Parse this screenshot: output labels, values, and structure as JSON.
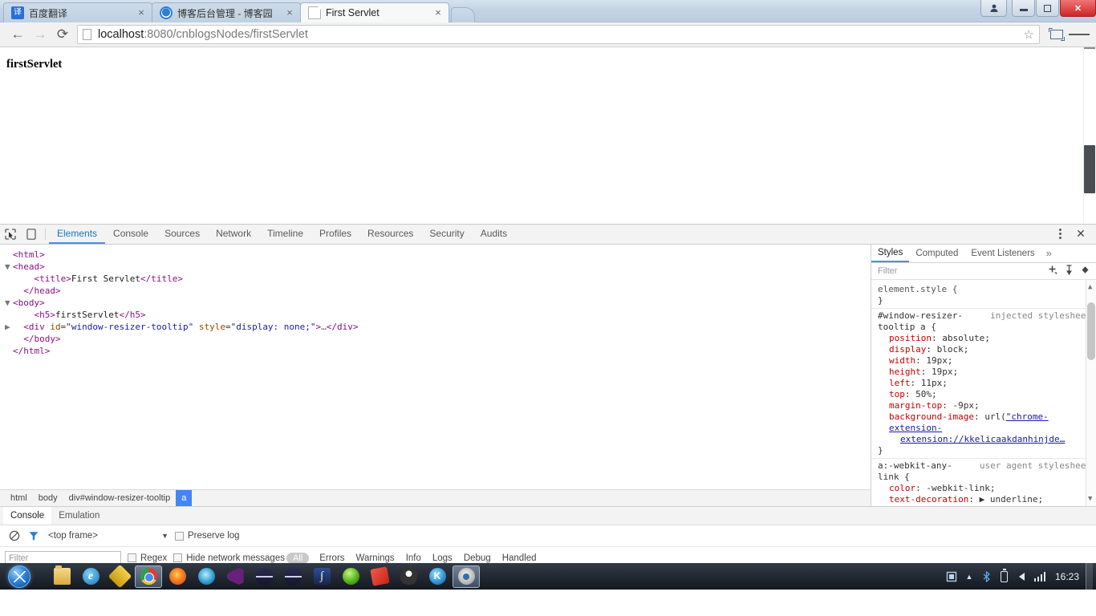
{
  "browser": {
    "tabs": [
      {
        "title": "百度翻译",
        "favicon": "baidu-fanyi-icon",
        "active": false,
        "close_label": "×"
      },
      {
        "title": "博客后台管理 - 博客园",
        "favicon": "cnblogs-icon",
        "active": false,
        "close_label": "×"
      },
      {
        "title": "First Servlet",
        "favicon": "document-icon",
        "active": true,
        "close_label": "×"
      }
    ],
    "window_controls": {
      "user_label": "■",
      "minimize_label": "",
      "restore_label": "",
      "close_label": "✕"
    },
    "toolbar": {
      "back_label": "←",
      "forward_label": "→",
      "reload_label": "⟳",
      "url_scheme_host": "localhost",
      "url_rest": ":8080/cnblogsNodes/firstServlet",
      "url_full": "localhost:8080/cnblogsNodes/firstServlet",
      "bookmark_label": "☆",
      "extension_label": "window-resizer",
      "menu_label": "≡"
    }
  },
  "page": {
    "heading": "firstServlet"
  },
  "devtools": {
    "toolbar_icons": [
      {
        "name": "inspect-element-icon",
        "glyph": "⬈"
      },
      {
        "name": "device-toolbar-icon",
        "glyph": "▯"
      }
    ],
    "tabs": [
      {
        "label": "Elements",
        "active": true
      },
      {
        "label": "Console",
        "active": false
      },
      {
        "label": "Sources",
        "active": false
      },
      {
        "label": "Network",
        "active": false
      },
      {
        "label": "Timeline",
        "active": false
      },
      {
        "label": "Profiles",
        "active": false
      },
      {
        "label": "Resources",
        "active": false
      },
      {
        "label": "Security",
        "active": false
      },
      {
        "label": "Audits",
        "active": false
      }
    ],
    "more_menu_label": "⋮",
    "close_label": "✕",
    "dom_tree": [
      {
        "indent": 0,
        "arrow": "",
        "html": "<span class=\"punc\">&lt;</span><span class=\"tagc\">html</span><span class=\"punc\">&gt;</span>"
      },
      {
        "indent": 0,
        "arrow": "▼",
        "html": "<span class=\"punc\">&lt;</span><span class=\"tagc\">head</span><span class=\"punc\">&gt;</span>"
      },
      {
        "indent": 2,
        "arrow": "",
        "html": "<span class=\"punc\">&lt;</span><span class=\"tagc\">title</span><span class=\"punc\">&gt;</span><span class=\"txt\">First Servlet</span><span class=\"punc\">&lt;/</span><span class=\"tagc\">title</span><span class=\"punc\">&gt;</span>"
      },
      {
        "indent": 1,
        "arrow": "",
        "html": "<span class=\"punc\">&lt;/</span><span class=\"tagc\">head</span><span class=\"punc\">&gt;</span>"
      },
      {
        "indent": 0,
        "arrow": "▼",
        "html": "<span class=\"punc\">&lt;</span><span class=\"tagc\">body</span><span class=\"punc\">&gt;</span>"
      },
      {
        "indent": 2,
        "arrow": "",
        "html": "<span class=\"punc\">&lt;</span><span class=\"tagc\">h5</span><span class=\"punc\">&gt;</span><span class=\"txt\">firstServlet</span><span class=\"punc\">&lt;/</span><span class=\"tagc\">h5</span><span class=\"punc\">&gt;</span>"
      },
      {
        "indent": 1,
        "arrow": "▶",
        "html": "<span class=\"punc\">&lt;</span><span class=\"tagc\">div</span> <span class=\"attrn\">id</span>=<span class=\"attrv\">\"window-resizer-tooltip\"</span> <span class=\"attrn\">style</span>=<span class=\"attrv\">\"display: none;\"</span><span class=\"punc\">&gt;</span><span class=\"ellip\">…</span><span class=\"punc\">&lt;/</span><span class=\"tagc\">div</span><span class=\"punc\">&gt;</span>"
      },
      {
        "indent": 1,
        "arrow": "",
        "html": "<span class=\"punc\">&lt;/</span><span class=\"tagc\">body</span><span class=\"punc\">&gt;</span>"
      },
      {
        "indent": 0,
        "arrow": "",
        "html": "<span class=\"punc\">&lt;/</span><span class=\"tagc\">html</span><span class=\"punc\">&gt;</span>"
      }
    ],
    "breadcrumb": [
      {
        "label": "html",
        "selected": false
      },
      {
        "label": "body",
        "selected": false
      },
      {
        "label": "div#window-resizer-tooltip",
        "selected": false
      },
      {
        "label": "a",
        "selected": true
      }
    ],
    "styles_panel": {
      "tabs": [
        {
          "label": "Styles",
          "active": true
        },
        {
          "label": "Computed",
          "active": false
        },
        {
          "label": "Event Listeners",
          "active": false
        }
      ],
      "more_label": "»",
      "filter_placeholder": "Filter",
      "icons": [
        {
          "name": "new-style-rule-icon",
          "glyph": "+"
        },
        {
          "name": "toggle-element-state-icon",
          "glyph": "⚑"
        },
        {
          "name": "class-filter-icon",
          "glyph": "◆"
        }
      ],
      "rules": [
        {
          "selector": "element.style {",
          "origin": "",
          "declarations": [],
          "closing": "}"
        },
        {
          "selector": "#window-resizer-tooltip a {",
          "selector_line1": "#window-resizer-",
          "selector_line2": "tooltip a {",
          "origin": "injected stylesheet",
          "declarations": [
            {
              "name": "position",
              "value": "absolute;"
            },
            {
              "name": "display",
              "value": "block;"
            },
            {
              "name": "width",
              "value": "19px;"
            },
            {
              "name": "height",
              "value": "19px;"
            },
            {
              "name": "left",
              "value": "11px;"
            },
            {
              "name": "top",
              "value": "50%;"
            },
            {
              "name": "margin-top",
              "value": "-9px;"
            },
            {
              "name": "background-image",
              "value": "url(",
              "link": "\"chrome-extension://kkelicaakdanhinjde…",
              "after": ""
            }
          ],
          "closing": "}"
        },
        {
          "selector": "a:-webkit-any-link {",
          "selector_line1": "a:-webkit-any-",
          "selector_line2": "link {",
          "origin": "user agent stylesheet",
          "declarations": [
            {
              "name": "color",
              "value": "-webkit-link;"
            },
            {
              "name": "text-decoration",
              "value": "▶ underline;"
            }
          ],
          "closing": ""
        }
      ]
    },
    "drawer": {
      "tabs": [
        {
          "label": "Console",
          "active": true
        },
        {
          "label": "Emulation",
          "active": false
        }
      ],
      "toolbar": {
        "clear_label": "⊘",
        "filter_label": "▽",
        "frame_value": "<top frame>",
        "frame_caret": "▼",
        "preserve_log_label": "Preserve log",
        "preserve_log_checked": false
      },
      "filterbar": {
        "filter_placeholder": "Filter",
        "regex_label": "Regex",
        "regex_checked": false,
        "hide_network_label": "Hide network messages",
        "hide_network_checked": false,
        "levels": [
          {
            "label": "All",
            "active": true
          },
          {
            "label": "Errors",
            "active": false
          },
          {
            "label": "Warnings",
            "active": false
          },
          {
            "label": "Info",
            "active": false
          },
          {
            "label": "Logs",
            "active": false
          },
          {
            "label": "Debug",
            "active": false
          },
          {
            "label": "Handled",
            "active": false
          }
        ]
      },
      "prompt": ">"
    }
  },
  "taskbar": {
    "start_label": "Start",
    "items": [
      {
        "name": "taskbar-explorer",
        "icon": "folder-icon",
        "running": false
      },
      {
        "name": "taskbar-internet-explorer",
        "icon": "ie-icon",
        "running": false,
        "glyph": "e"
      },
      {
        "name": "taskbar-ie-tester",
        "icon": "ie-diamond-icon",
        "running": false
      },
      {
        "name": "taskbar-chrome",
        "icon": "chrome-icon",
        "running": true
      },
      {
        "name": "taskbar-firefox",
        "icon": "firefox-icon",
        "running": false
      },
      {
        "name": "taskbar-opera",
        "icon": "opera-icon",
        "running": false
      },
      {
        "name": "taskbar-visual-studio",
        "icon": "visual-studio-icon",
        "running": false
      },
      {
        "name": "taskbar-database-1",
        "icon": "database-icon",
        "running": false
      },
      {
        "name": "taskbar-database-2",
        "icon": "database-icon",
        "running": false
      },
      {
        "name": "taskbar-editor",
        "icon": "pen-icon",
        "running": false,
        "glyph": "∫"
      },
      {
        "name": "taskbar-green-app",
        "icon": "green-ball-icon",
        "running": false
      },
      {
        "name": "taskbar-red-app",
        "icon": "red-app-icon",
        "running": false
      },
      {
        "name": "taskbar-tux",
        "icon": "tux-icon",
        "running": false
      },
      {
        "name": "taskbar-kugou",
        "icon": "k-circle-icon",
        "running": false,
        "glyph": "K"
      },
      {
        "name": "taskbar-settings",
        "icon": "gear-icon",
        "running": true
      }
    ],
    "tray": {
      "action_center_label": "▣",
      "show_hidden_label": "▲",
      "bluetooth_label": "ᛦ",
      "battery_label": "battery-icon",
      "volume_label": "speaker-icon",
      "network_label": "signal-bars-icon",
      "clock": "16:23"
    }
  },
  "colors": {
    "accent_blue": "#4285f4",
    "devtools_tab_active": "#1a73c7",
    "close_red": "#cf2525",
    "property_red": "#c80000",
    "tag_purple": "#881280",
    "attr_orange": "#994500",
    "value_blue": "#1a1aa6"
  }
}
